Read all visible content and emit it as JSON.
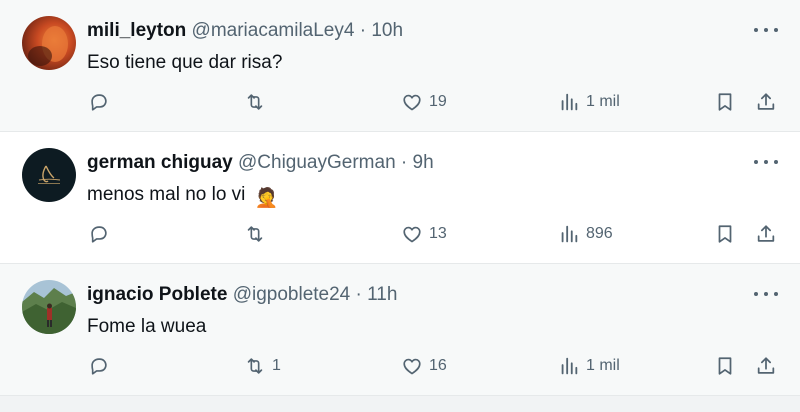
{
  "tweets": [
    {
      "name": "mili_leyton",
      "handle": "@mariacamilaLey4",
      "separator": "·",
      "time": "10h",
      "text": "Eso tiene que dar risa?",
      "emoji": "",
      "replies": "",
      "retweets": "",
      "likes": "19",
      "views": "1 mil",
      "avatar_color": "#c0502a"
    },
    {
      "name": "german chiguay",
      "handle": "@ChiguayGerman",
      "separator": "·",
      "time": "9h",
      "text": "menos mal no lo vi",
      "emoji": "🤦",
      "replies": "",
      "retweets": "",
      "likes": "13",
      "views": "896",
      "avatar_color": "#0d1b22"
    },
    {
      "name": "ignacio Poblete",
      "handle": "@igpoblete24",
      "separator": "·",
      "time": "11h",
      "text": "Fome la wuea",
      "emoji": "",
      "replies": "",
      "retweets": "1",
      "likes": "16",
      "views": "1 mil",
      "avatar_color": "#4f7a4a"
    }
  ],
  "icons": {
    "reply": "reply-icon",
    "retweet": "retweet-icon",
    "like": "heart-icon",
    "views": "views-icon",
    "bookmark": "bookmark-icon",
    "share": "share-icon",
    "more": "more-icon"
  },
  "colors": {
    "text": "#0f1419",
    "secondary": "#536471",
    "divider": "#e6e9ea"
  }
}
